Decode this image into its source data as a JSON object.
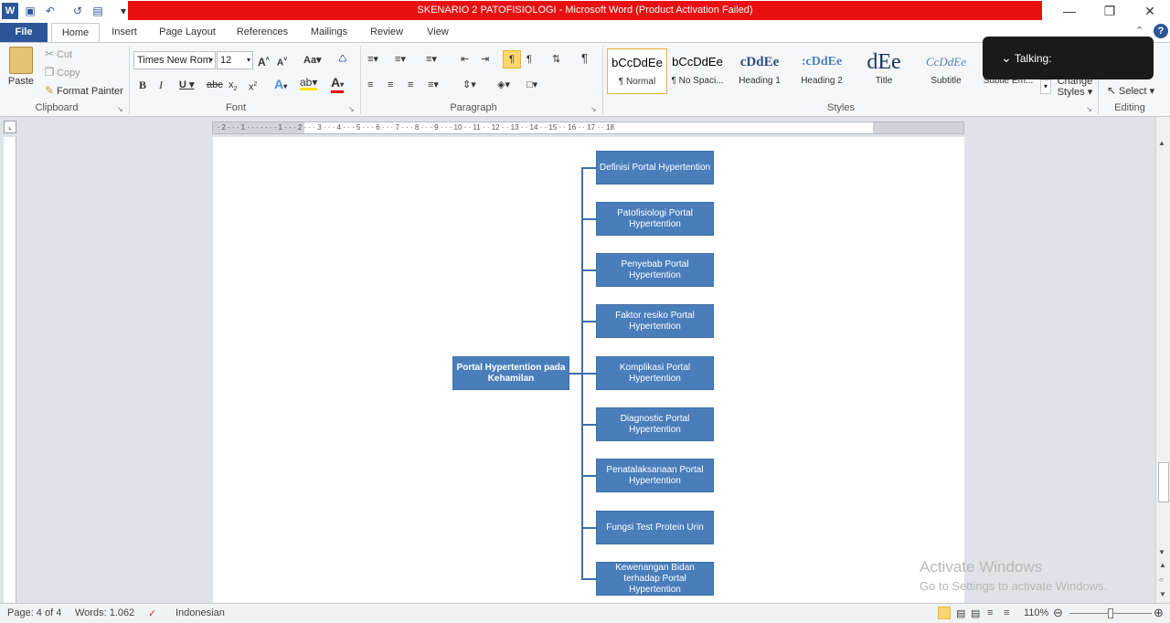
{
  "window": {
    "title": "SKENARIO 2 PATOFISIOLOGI  -  Microsoft Word (Product Activation Failed)",
    "app_icon": "W"
  },
  "tabs": [
    "File",
    "Home",
    "Insert",
    "Page Layout",
    "References",
    "Mailings",
    "Review",
    "View"
  ],
  "clipboard": {
    "paste": "Paste",
    "cut": "Cut",
    "copy": "Copy",
    "format_painter": "Format Painter",
    "label": "Clipboard"
  },
  "font": {
    "name": "Times New Rom",
    "size": "12",
    "label": "Font"
  },
  "paragraph": {
    "label": "Paragraph"
  },
  "styles": {
    "label": "Styles",
    "items": [
      {
        "preview": "bCcDdEe",
        "name": "¶ Normal"
      },
      {
        "preview": "bCcDdEe",
        "name": "¶ No Spaci..."
      },
      {
        "preview": "cDdEe",
        "name": "Heading 1"
      },
      {
        "preview": ":cDdEe",
        "name": "Heading 2"
      },
      {
        "preview": "dEe",
        "name": "Title"
      },
      {
        "preview": "CcDdEe",
        "name": "Subtitle"
      },
      {
        "preview": "",
        "name": "Subtle Em..."
      }
    ],
    "change_styles": "Change Styles"
  },
  "editing": {
    "select": "Select",
    "label": "Editing"
  },
  "talking": "Talking:",
  "diagram": {
    "root": "Portal Hypertention pada Kehamilan",
    "children": [
      "Definisi Portal Hypertention",
      "Patofisiologi Portal Hypertention",
      "Penyebab Portal Hypertention",
      "Faktor resiko Portal Hypertention",
      "Komplikasi Portal Hypertention",
      "Diagnostic Portal Hypertention",
      "Penatalaksanaan Portal Hypertention",
      "Fungsi Test Protein Urin",
      "Kewenangan Bidan terhadap Portal Hypertention"
    ]
  },
  "statusbar": {
    "page": "Page: 4 of 4",
    "words": "Words: 1.062",
    "language": "Indonesian",
    "zoom": "110%"
  },
  "watermark": {
    "line1": "Activate Windows",
    "line2": "Go to Settings to activate Windows."
  }
}
